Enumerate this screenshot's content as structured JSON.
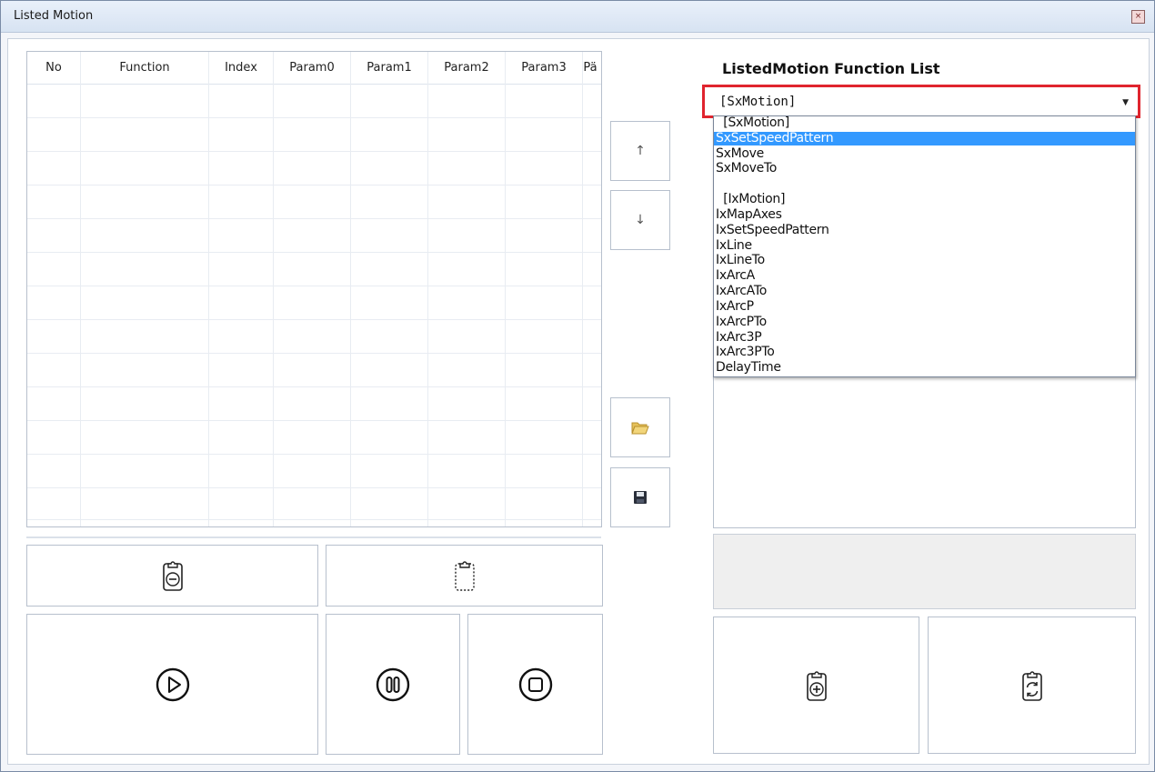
{
  "window": {
    "title": "Listed Motion",
    "close_glyph": "×"
  },
  "grid": {
    "columns": [
      "No",
      "Function",
      "Index",
      "Param0",
      "Param1",
      "Param2",
      "Param3",
      "Pä"
    ],
    "rows": []
  },
  "buttons": {
    "move_up_glyph": "↑",
    "move_down_glyph": "↓",
    "open_icon": "folder-open-icon",
    "save_icon": "save-disk-icon",
    "remove_icon": "clipboard-minus-icon",
    "clear_icon": "clipboard-empty-icon",
    "play_icon": "play-circle-icon",
    "pause_icon": "pause-circle-icon",
    "stop_icon": "stop-circle-icon",
    "add_icon": "clipboard-plus-icon",
    "refresh_icon": "clipboard-refresh-icon"
  },
  "function_list": {
    "title": "ListedMotion Function List",
    "selected_value": "[SxMotion]",
    "options": [
      "  [SxMotion]",
      "SxSetSpeedPattern",
      "SxMove",
      "SxMoveTo",
      "",
      "  [IxMotion]",
      "IxMapAxes",
      "IxSetSpeedPattern",
      "IxLine",
      "IxLineTo",
      "IxArcA",
      "IxArcATo",
      "IxArcP",
      "IxArcPTo",
      "IxArc3P",
      "IxArc3PTo",
      "DelayTime"
    ],
    "highlighted_index": 1
  },
  "colors": {
    "accent_border": "#e0242e",
    "selection": "#3399ff"
  }
}
